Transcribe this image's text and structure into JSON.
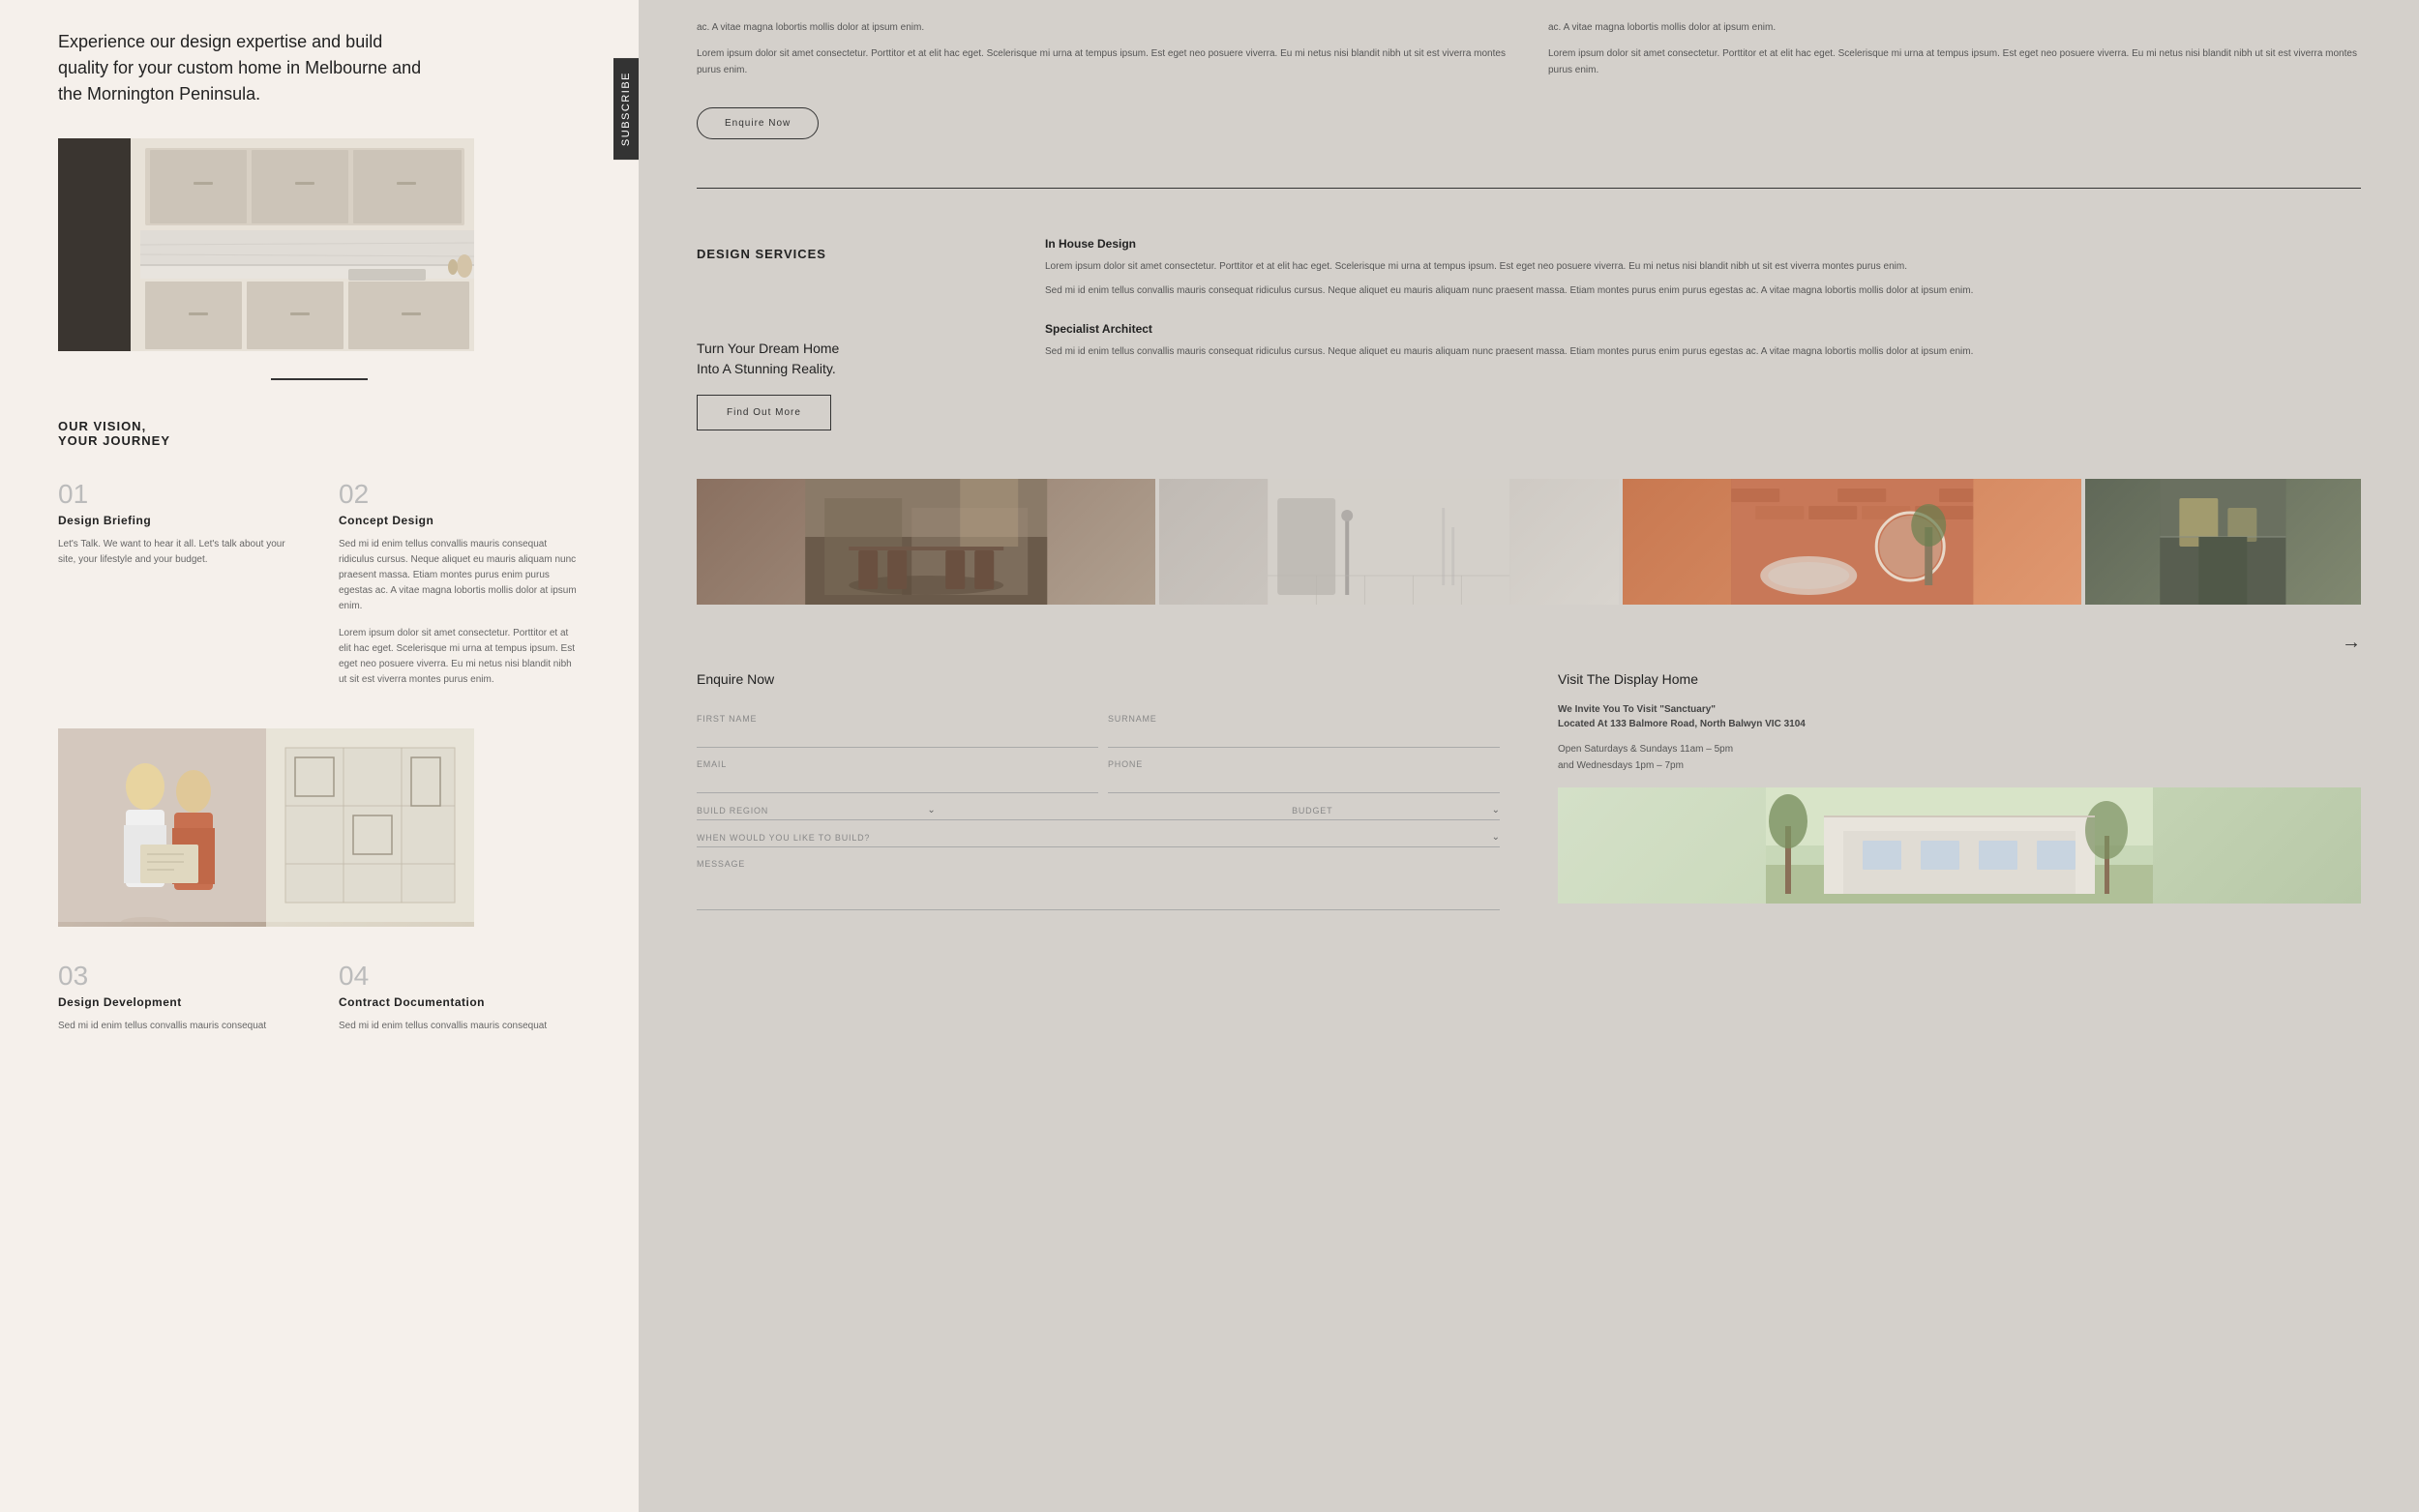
{
  "subscribe_tab": "Subscribe",
  "hero_text": "Experience our design expertise and build quality for your custom home in Melbourne and the Mornington Peninsula.",
  "section_title": "OUR VISION,\nYOUR JOURNEY",
  "steps": [
    {
      "number": "01",
      "title": "Design Briefing",
      "text": "Let's Talk. We want to hear it all. Let's talk about your site, your lifestyle and your budget."
    },
    {
      "number": "02",
      "title": "Concept Design",
      "text": "Sed mi id enim tellus convallis mauris consequat ridiculus cursus. Neque aliquet eu mauris aliquam nunc praesent massa. Etiam montes purus enim purus egestas ac. A vitae magna lobortis mollis dolor at ipsum enim.\n\nLorem ipsum dolor sit amet consectetur. Porttitor et at elit hac eget. Scelerisque mi urna at tempus ipsum. Est eget neo posuere viverra. Eu mi netus nisi blandit nibh ut sit est viverra montes purus enim."
    },
    {
      "number": "03",
      "title": "Design Development",
      "text": "Sed mi id enim tellus convallis mauris consequat"
    },
    {
      "number": "04",
      "title": "Contract Documentation",
      "text": "Sed mi id enim tellus convallis mauris consequat"
    }
  ],
  "right_panel": {
    "top_left_text": "ac. A vitae magna lobortis mollis dolor at ipsum enim.\n\nLorem ipsum dolor sit amet consectetur. Porttitor et at elit hac eget. Scelerisque mi urna at tempus ipsum. Est eget neo posuere viverra. Eu mi netus nisi blandit nibh ut sit est viverra montes purus enim.",
    "top_right_text": "ac. A vitae magna lobortis mollis dolor at ipsum enim.\n\nLorem ipsum dolor sit amet consectetur. Porttitor et at elit hac eget. Scelerisque mi urna at tempus ipsum. Est eget neo posuere viverra. Eu mi netus nisi blandit nibh ut sit est viverra montes purus enim.",
    "enquire_btn_label": "Enquire Now",
    "design_services_title": "DESIGN SERVICES",
    "services": [
      {
        "title": "In House Design",
        "text": "Lorem ipsum dolor sit amet consectetur. Porttitor et at elit hac eget. Scelerisque mi urna at tempus ipsum. Est eget neo posuere viverra. Eu mi netus nisi blandit nibh ut sit est viverra montes purus enim.\n\nSed mi id enim tellus convallis mauris consequat ridiculus cursus. Neque aliquet eu mauris aliquam nunc praesent massa. Etiam montes purus enim purus egestas ac. A vitae magna lobortis mollis dolor at ipsum enim."
      },
      {
        "title": "Specialist Architect",
        "text": "Sed mi id enim tellus convallis mauris consequat ridiculus cursus. Neque aliquet eu mauris aliquam nunc praesent massa. Etiam montes purus enim purus egestas ac. A vitae magna lobortis mollis dolor at ipsum enim."
      }
    ],
    "dream_home_text": "Turn Your Dream Home\nInto A Stunning Reality.",
    "find_out_btn": "Find Out More",
    "gallery_arrow": "→",
    "enquire_form": {
      "title": "Enquire Now",
      "fields": {
        "first_name": "FIRST NAME",
        "surname": "SURNAME",
        "email": "EMAIL",
        "phone": "PHONE",
        "build_region": "BUILD REGION",
        "budget": "BUDGET",
        "when_build": "WHEN WOULD YOU LIKE TO BUILD?",
        "message": "MESSAGE"
      }
    },
    "display_home": {
      "title": "Visit The Display Home",
      "subtitle": "We Invite You To Visit \"Sanctuary\"\nLocated At 133 Balmore Road, North Balwyn VIC 3104",
      "hours": "Open Saturdays & Sundays 11am – 5pm\nand Wednesdays 1pm – 7pm"
    }
  }
}
